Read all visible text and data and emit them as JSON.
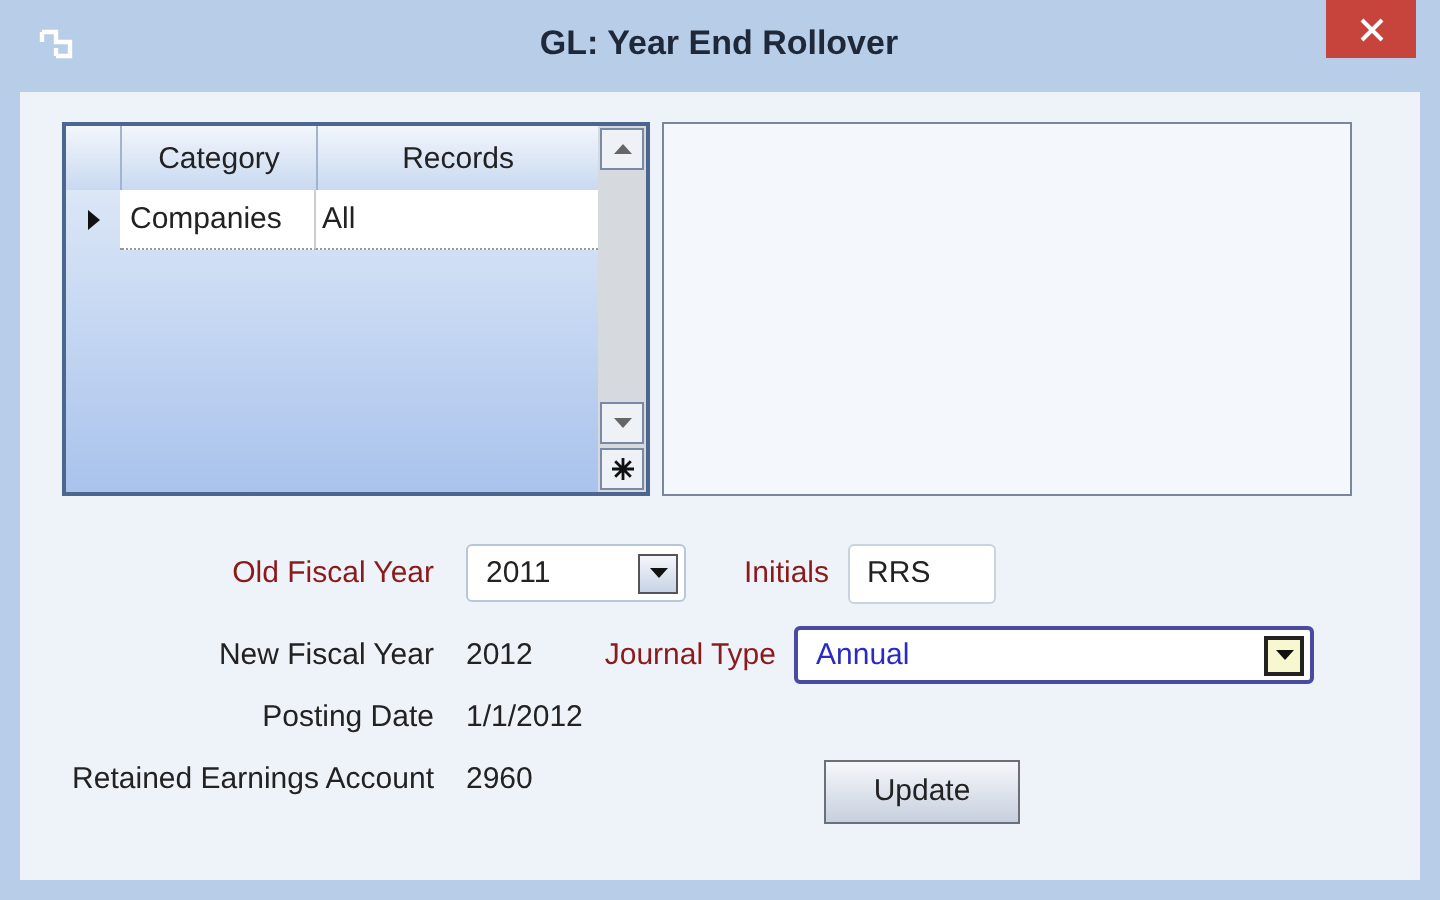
{
  "window": {
    "title": "GL: Year End Rollover"
  },
  "grid": {
    "columns": [
      "Category",
      "Records"
    ],
    "rows": [
      {
        "category": "Companies",
        "records": "All",
        "selected": true
      }
    ]
  },
  "form": {
    "old_fiscal_year": {
      "label": "Old Fiscal Year",
      "value": "2011"
    },
    "initials": {
      "label": "Initials",
      "value": "RRS"
    },
    "new_fiscal_year": {
      "label": "New Fiscal Year",
      "value": "2012"
    },
    "journal_type": {
      "label": "Journal Type",
      "value": "Annual"
    },
    "posting_date": {
      "label": "Posting Date",
      "value": "1/1/2012"
    },
    "retained_earnings_account": {
      "label": "Retained Earnings Account",
      "value": "2960"
    }
  },
  "buttons": [
    "Update"
  ]
}
